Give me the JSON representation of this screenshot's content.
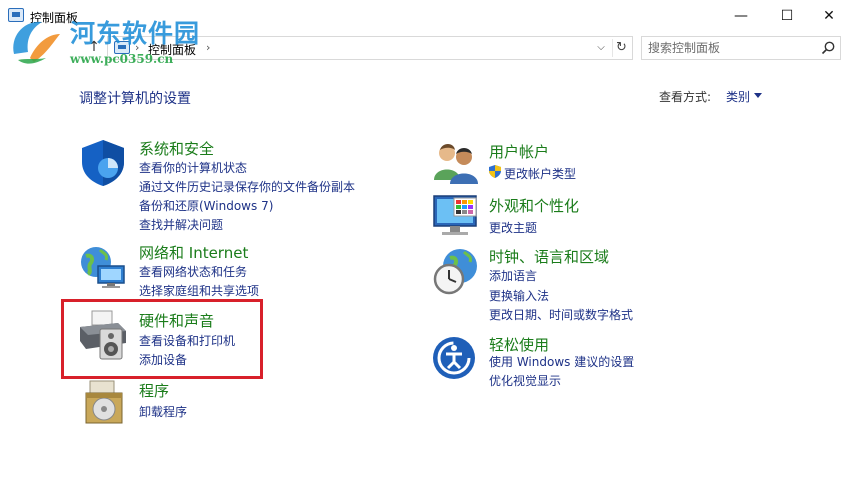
{
  "window": {
    "title": "控制面板",
    "minimize_glyph": "—",
    "maximize_glyph": "☐",
    "close_glyph": "✕"
  },
  "watermark": {
    "site_name": "河东软件园",
    "url": "www.pc0359.cn"
  },
  "address_bar": {
    "up_glyph": "↑",
    "separator": "›",
    "path": "控制面板",
    "dropdown_glyph": "⌵",
    "refresh_glyph": "↻"
  },
  "search": {
    "placeholder": "搜索控制面板"
  },
  "header": {
    "title": "调整计算机的设置",
    "view_by_label": "查看方式:",
    "view_by_value": "类别"
  },
  "categories": {
    "system_security": {
      "title": "系统和安全",
      "links": [
        "查看你的计算机状态",
        "通过文件历史记录保存你的文件备份副本",
        "备份和还原(Windows 7)",
        "查找并解决问题"
      ]
    },
    "network": {
      "title": "网络和 Internet",
      "links": [
        "查看网络状态和任务",
        "选择家庭组和共享选项"
      ]
    },
    "hardware_sound": {
      "title": "硬件和声音",
      "links": [
        "查看设备和打印机",
        "添加设备"
      ]
    },
    "programs": {
      "title": "程序",
      "links": [
        "卸载程序"
      ]
    },
    "user_accounts": {
      "title": "用户帐户",
      "links": [
        "更改帐户类型"
      ]
    },
    "appearance": {
      "title": "外观和个性化",
      "links": [
        "更改主题"
      ]
    },
    "clock_region": {
      "title": "时钟、语言和区域",
      "links": [
        "添加语言",
        "更换输入法",
        "更改日期、时间或数字格式"
      ]
    },
    "ease_of_access": {
      "title": "轻松使用",
      "links": [
        "使用 Windows 建议的设置",
        "优化视觉显示"
      ]
    }
  },
  "colors": {
    "category_title": "#1a7c1a",
    "link": "#1e3287",
    "highlight": "#d8202a"
  }
}
